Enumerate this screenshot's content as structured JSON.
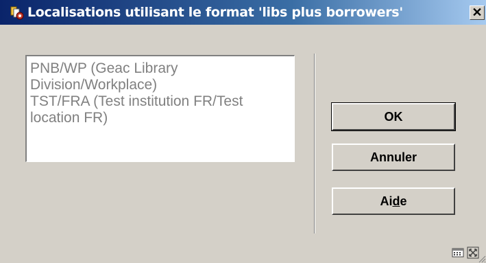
{
  "window": {
    "title": "Localisations utilisant le format 'libs plus borrowers'",
    "close_label": "✕"
  },
  "listbox": {
    "items": [
      "PNB/WP  (Geac Library Division/Workplace)",
      "TST/FRA  (Test institution FR/Test location FR)"
    ]
  },
  "buttons": {
    "ok": "OK",
    "cancel": "Annuler",
    "help_prefix": "Ai",
    "help_mnemonic": "d",
    "help_suffix": "e"
  },
  "icons": {
    "title": "app-icon",
    "status_1": "calculator-icon",
    "status_2": "maximize-icon"
  }
}
